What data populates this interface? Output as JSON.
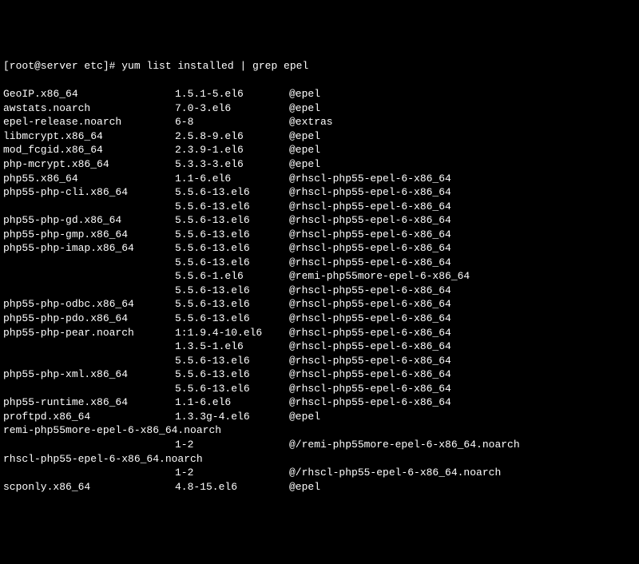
{
  "prompt": "[root@server etc]# yum list installed | grep epel",
  "rows": [
    {
      "pkg": "GeoIP.x86_64",
      "ver": "1.5.1-5.el6",
      "repo": "@epel"
    },
    {
      "pkg": "awstats.noarch",
      "ver": "7.0-3.el6",
      "repo": "@epel"
    },
    {
      "pkg": "epel-release.noarch",
      "ver": "6-8",
      "repo": "@extras"
    },
    {
      "pkg": "libmcrypt.x86_64",
      "ver": "2.5.8-9.el6",
      "repo": "@epel"
    },
    {
      "pkg": "mod_fcgid.x86_64",
      "ver": "2.3.9-1.el6",
      "repo": "@epel"
    },
    {
      "pkg": "php-mcrypt.x86_64",
      "ver": "5.3.3-3.el6",
      "repo": "@epel"
    },
    {
      "pkg": "php55.x86_64",
      "ver": "1.1-6.el6",
      "repo": "@rhscl-php55-epel-6-x86_64"
    },
    {
      "pkg": "php55-php-cli.x86_64",
      "ver": "5.5.6-13.el6",
      "repo": "@rhscl-php55-epel-6-x86_64"
    },
    {
      "pkg": "",
      "ver": "5.5.6-13.el6",
      "repo": "@rhscl-php55-epel-6-x86_64"
    },
    {
      "pkg": "php55-php-gd.x86_64",
      "ver": "5.5.6-13.el6",
      "repo": "@rhscl-php55-epel-6-x86_64"
    },
    {
      "pkg": "php55-php-gmp.x86_64",
      "ver": "5.5.6-13.el6",
      "repo": "@rhscl-php55-epel-6-x86_64"
    },
    {
      "pkg": "php55-php-imap.x86_64",
      "ver": "5.5.6-13.el6",
      "repo": "@rhscl-php55-epel-6-x86_64"
    },
    {
      "pkg": "",
      "ver": "5.5.6-13.el6",
      "repo": "@rhscl-php55-epel-6-x86_64"
    },
    {
      "pkg": "",
      "ver": "5.5.6-1.el6",
      "repo": "@remi-php55more-epel-6-x86_64"
    },
    {
      "pkg": "",
      "ver": "5.5.6-13.el6",
      "repo": "@rhscl-php55-epel-6-x86_64"
    },
    {
      "pkg": "php55-php-odbc.x86_64",
      "ver": "5.5.6-13.el6",
      "repo": "@rhscl-php55-epel-6-x86_64"
    },
    {
      "pkg": "php55-php-pdo.x86_64",
      "ver": "5.5.6-13.el6",
      "repo": "@rhscl-php55-epel-6-x86_64"
    },
    {
      "pkg": "php55-php-pear.noarch",
      "ver": "1:1.9.4-10.el6",
      "repo": "@rhscl-php55-epel-6-x86_64"
    },
    {
      "pkg": "",
      "ver": "1.3.5-1.el6",
      "repo": "@rhscl-php55-epel-6-x86_64"
    },
    {
      "pkg": "",
      "ver": "5.5.6-13.el6",
      "repo": "@rhscl-php55-epel-6-x86_64"
    },
    {
      "pkg": "php55-php-xml.x86_64",
      "ver": "5.5.6-13.el6",
      "repo": "@rhscl-php55-epel-6-x86_64"
    },
    {
      "pkg": "",
      "ver": "5.5.6-13.el6",
      "repo": "@rhscl-php55-epel-6-x86_64"
    },
    {
      "pkg": "php55-runtime.x86_64",
      "ver": "1.1-6.el6",
      "repo": "@rhscl-php55-epel-6-x86_64"
    },
    {
      "pkg": "proftpd.x86_64",
      "ver": "1.3.3g-4.el6",
      "repo": "@epel"
    },
    {
      "pkg_full": "remi-php55more-epel-6-x86_64.noarch"
    },
    {
      "pkg": "",
      "ver": "1-2",
      "repo": "@/remi-php55more-epel-6-x86_64.noarch"
    },
    {
      "pkg_full": "rhscl-php55-epel-6-x86_64.noarch"
    },
    {
      "pkg": "",
      "ver": "1-2",
      "repo": "@/rhscl-php55-epel-6-x86_64.noarch"
    },
    {
      "pkg": "scponly.x86_64",
      "ver": "4.8-15.el6",
      "repo": "@epel"
    }
  ]
}
